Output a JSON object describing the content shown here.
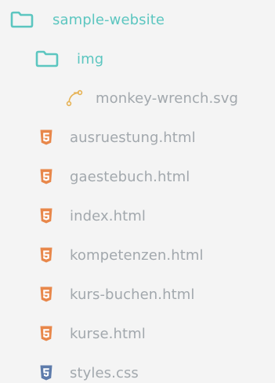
{
  "tree": {
    "root": {
      "name": "sample-website",
      "icon": "folder-icon"
    },
    "subfolder": {
      "name": "img",
      "icon": "folder-icon"
    },
    "subfolder_files": [
      {
        "name": "monkey-wrench.svg",
        "icon": "svg-file-icon"
      }
    ],
    "files": [
      {
        "name": "ausruestung.html",
        "icon": "html5-icon"
      },
      {
        "name": "gaestebuch.html",
        "icon": "html5-icon"
      },
      {
        "name": "index.html",
        "icon": "html5-icon"
      },
      {
        "name": "kompetenzen.html",
        "icon": "html5-icon"
      },
      {
        "name": "kurs-buchen.html",
        "icon": "html5-icon"
      },
      {
        "name": "kurse.html",
        "icon": "html5-icon"
      },
      {
        "name": "styles.css",
        "icon": "css3-icon"
      }
    ]
  },
  "colors": {
    "background": "#f4f4f4",
    "folder": "#5cc6c0",
    "file_text": "#a2a8ad",
    "html_icon": "#e8874a",
    "css_icon": "#5d7bab",
    "svg_icon": "#e6b254"
  }
}
